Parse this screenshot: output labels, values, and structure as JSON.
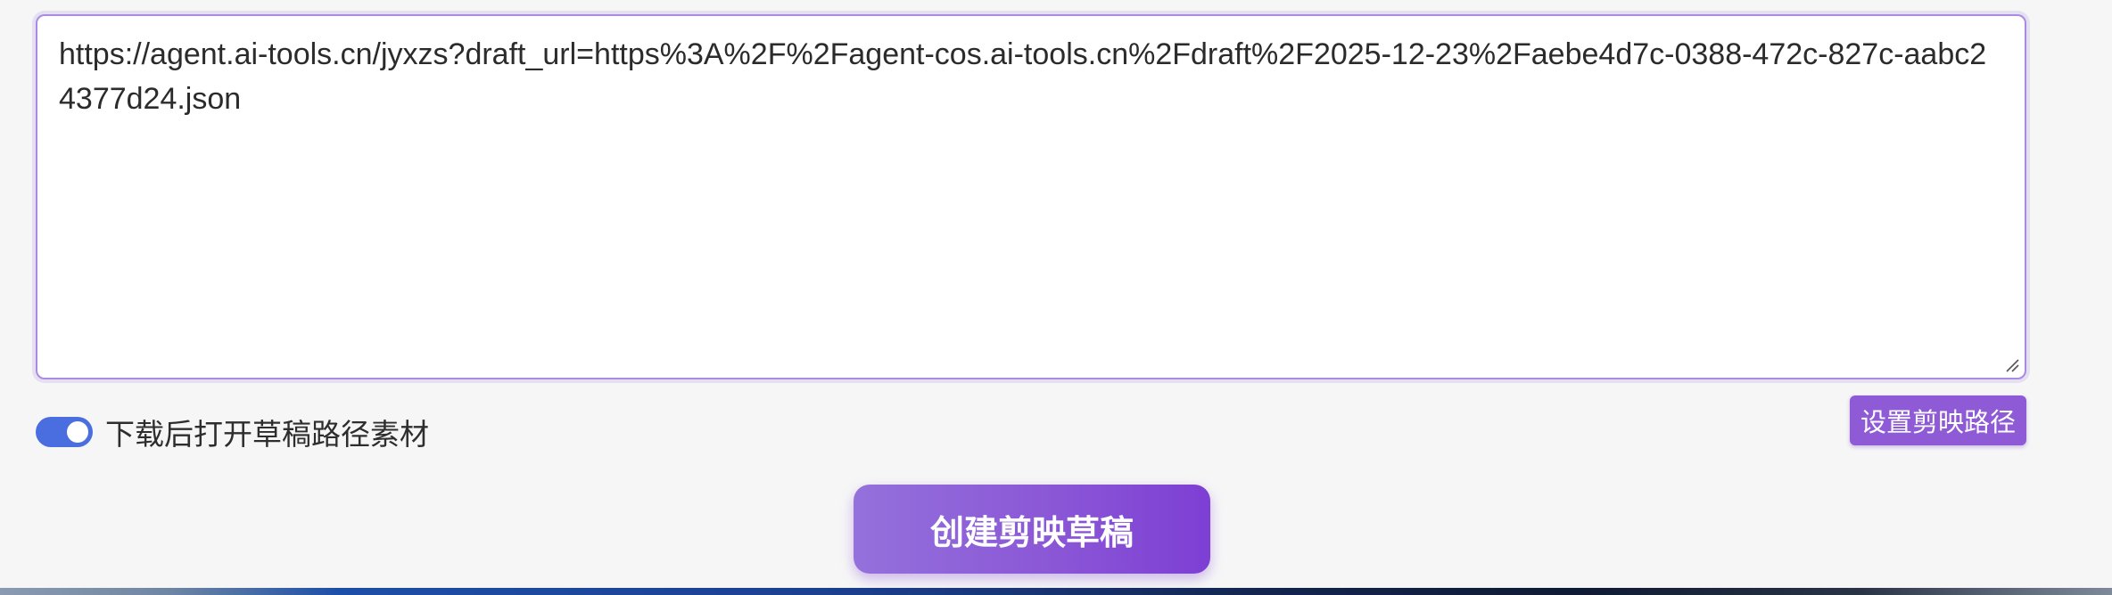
{
  "url_input": {
    "value": "https://agent.ai-tools.cn/jyxzs?draft_url=https%3A%2F%2Fagent-cos.ai-tools.cn%2Fdraft%2F2025-12-23%2Faebe4d7c-0388-472c-827c-aabc24377d24.json"
  },
  "toggle": {
    "label": "下载后打开草稿路径素材",
    "on": true
  },
  "set_path_button": {
    "label": "设置剪映路径"
  },
  "create_button": {
    "label": "创建剪映草稿"
  },
  "colors": {
    "accent": "#8e5ad6",
    "toggle_on": "#4a6ee0",
    "border": "#a98be3"
  }
}
